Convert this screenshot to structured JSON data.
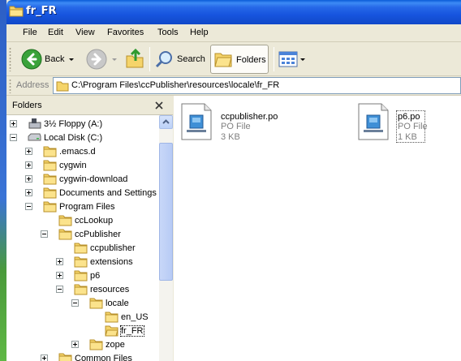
{
  "window": {
    "title": "fr_FR"
  },
  "menu": {
    "items": [
      "File",
      "Edit",
      "View",
      "Favorites",
      "Tools",
      "Help"
    ]
  },
  "toolbar": {
    "back_label": "Back",
    "search_label": "Search",
    "folders_label": "Folders"
  },
  "address": {
    "label": "Address",
    "path": "C:\\Program Files\\ccPublisher\\resources\\locale\\fr_FR"
  },
  "folders_pane": {
    "title": "Folders",
    "tree": [
      {
        "label": "3½ Floppy (A:)",
        "icon": "floppy-drive-icon",
        "expander": "plus"
      },
      {
        "label": "Local Disk (C:)",
        "icon": "hard-drive-icon",
        "expander": "minus"
      },
      {
        "label": ".emacs.d",
        "icon": "folder-icon",
        "expander": "plus"
      },
      {
        "label": "cygwin",
        "icon": "folder-icon",
        "expander": "plus"
      },
      {
        "label": "cygwin-download",
        "icon": "folder-icon",
        "expander": "plus"
      },
      {
        "label": "Documents and Settings",
        "icon": "folder-icon",
        "expander": "plus"
      },
      {
        "label": "Program Files",
        "icon": "folder-icon",
        "expander": "minus"
      },
      {
        "label": "ccLookup",
        "icon": "folder-icon",
        "expander": "none"
      },
      {
        "label": "ccPublisher",
        "icon": "folder-icon",
        "expander": "minus"
      },
      {
        "label": "ccpublisher",
        "icon": "folder-icon",
        "expander": "none"
      },
      {
        "label": "extensions",
        "icon": "folder-icon",
        "expander": "plus"
      },
      {
        "label": "p6",
        "icon": "folder-icon",
        "expander": "plus"
      },
      {
        "label": "resources",
        "icon": "folder-icon",
        "expander": "minus"
      },
      {
        "label": "locale",
        "icon": "folder-icon",
        "expander": "minus"
      },
      {
        "label": "en_US",
        "icon": "folder-icon",
        "expander": "none"
      },
      {
        "label": "fr_FR",
        "icon": "folder-open-icon",
        "expander": "none",
        "selected": true
      },
      {
        "label": "zope",
        "icon": "folder-icon",
        "expander": "plus"
      },
      {
        "label": "Common Files",
        "icon": "folder-icon",
        "expander": "plus"
      }
    ]
  },
  "files": [
    {
      "name": "ccpublisher.po",
      "type": "PO File",
      "size": "3 KB"
    },
    {
      "name": "p6.po",
      "type": "PO File",
      "size": "1 KB",
      "focused": true
    }
  ],
  "colors": {
    "titlebar": "#0a5bd8",
    "folder": "#f5d46a",
    "chrome": "#ece9d8"
  }
}
